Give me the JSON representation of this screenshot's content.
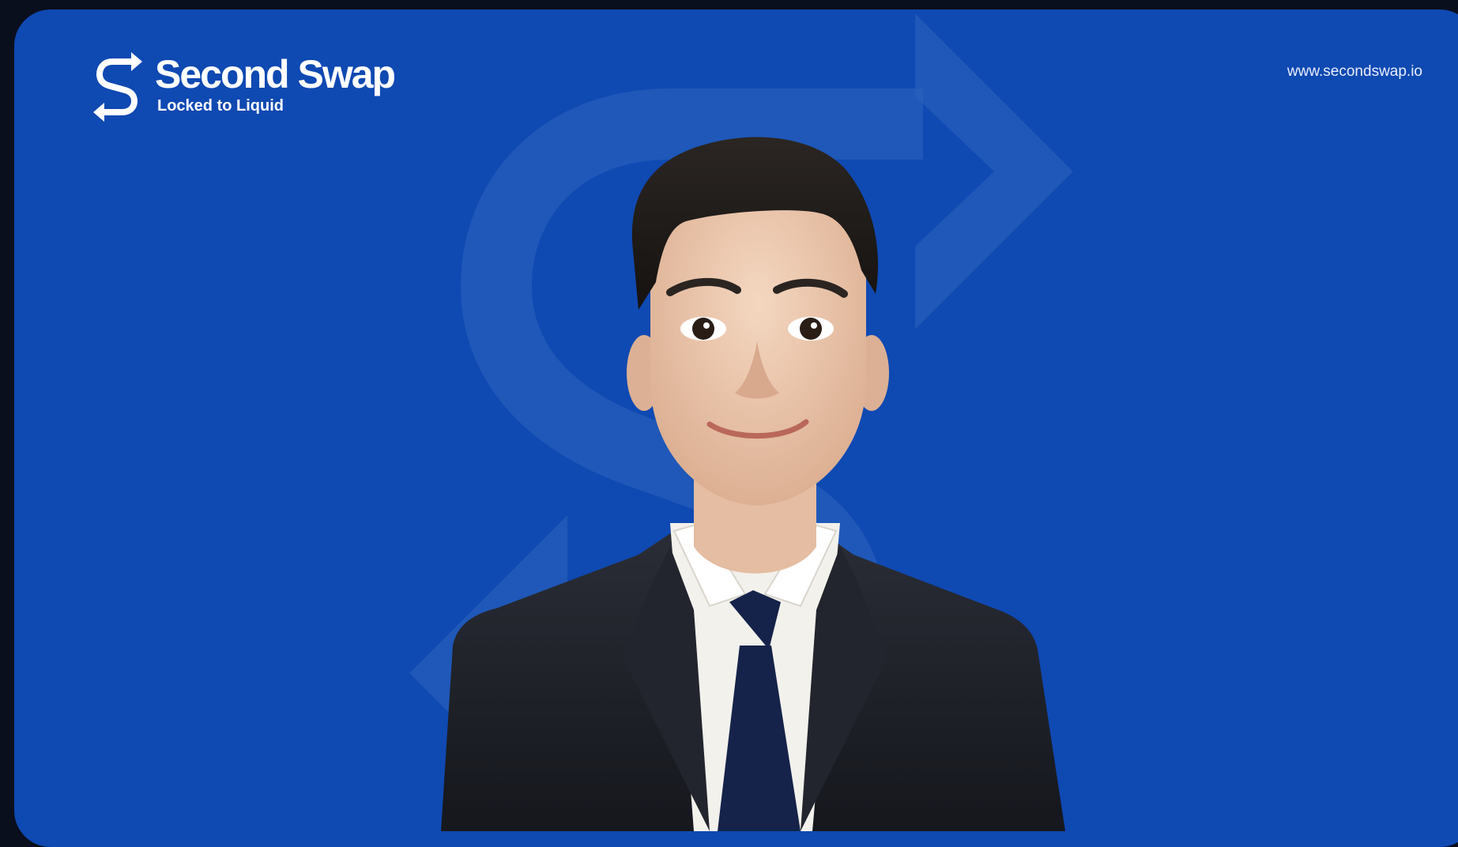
{
  "brand": {
    "name": "Second Swap",
    "tagline": "Locked to Liquid",
    "icon": "secondswap-s-arrows-icon"
  },
  "header": {
    "url": "www.secondswap.io"
  },
  "hero": {
    "image": "cartoon-businessman-avatar"
  },
  "colors": {
    "background": "#0a0f1e",
    "card": "#0f49b2",
    "watermark": "#2a62bd",
    "text": "#ffffff",
    "suit": "#1b1e26",
    "tie": "#15234a",
    "shirt": "#f3f1ec"
  }
}
